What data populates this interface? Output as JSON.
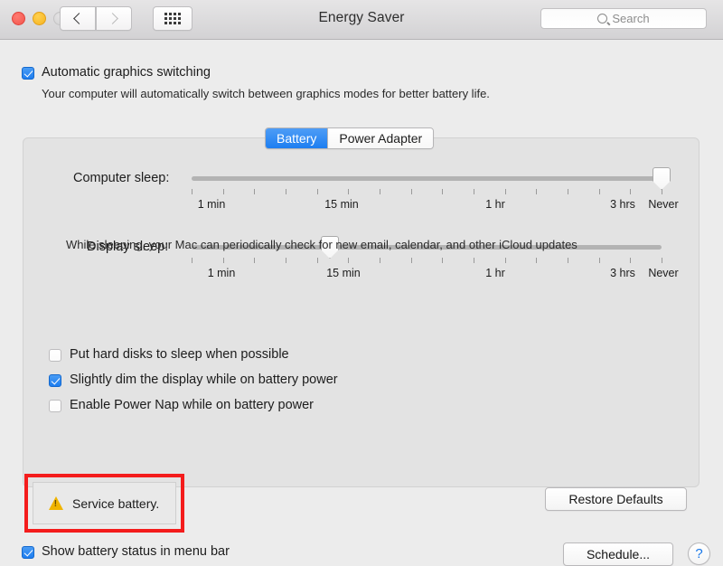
{
  "window": {
    "title": "Energy Saver",
    "traffic_lights": [
      "close",
      "minimize",
      "zoom"
    ],
    "nav_back": "back-chevron",
    "nav_forward": "forward-chevron",
    "show_all": "show-all-grid"
  },
  "search": {
    "placeholder": "Search",
    "value": "",
    "icon": "search-icon"
  },
  "graphics_switching": {
    "label": "Automatic graphics switching",
    "checked": true,
    "description": "Your computer will automatically switch between graphics modes for better battery life."
  },
  "tabs": {
    "items": [
      {
        "label": "Battery",
        "selected": true
      },
      {
        "label": "Power Adapter",
        "selected": false
      }
    ]
  },
  "sliders": [
    {
      "label": "Computer sleep:",
      "value": "Never",
      "value_position_pct": 100,
      "tick_labels": [
        {
          "text": "1 min",
          "pos_pct": 2
        },
        {
          "text": "15 min",
          "pos_pct": 27.5
        },
        {
          "text": "1 hr",
          "pos_pct": 59.5
        },
        {
          "text": "3 hrs",
          "pos_pct": 92
        },
        {
          "text": "Never",
          "pos_pct": 100
        }
      ],
      "tick_count": 16
    },
    {
      "label": "Display sleep:",
      "value": "15 min",
      "value_position_pct": 27.5,
      "tick_labels": [
        {
          "text": "1 min",
          "pos_pct": 2
        },
        {
          "text": "15 min",
          "pos_pct": 27.5
        },
        {
          "text": "1 hr",
          "pos_pct": 59.5
        },
        {
          "text": "3 hrs",
          "pos_pct": 92
        },
        {
          "text": "Never",
          "pos_pct": 100
        }
      ],
      "tick_count": 16
    }
  ],
  "options": [
    {
      "label": "Put hard disks to sleep when possible",
      "checked": false
    },
    {
      "label": "Slightly dim the display while on battery power",
      "checked": true
    },
    {
      "label": "Enable Power Nap while on battery power",
      "checked": false
    }
  ],
  "power_nap_description": "While sleeping, your Mac can periodically check for new email, calendar, and other iCloud updates",
  "service_battery": {
    "text": "Service battery.",
    "icon": "warning-triangle-icon",
    "annotation_color": "#f41c1c",
    "icon_color": "#f0b400"
  },
  "buttons": {
    "restore_defaults": "Restore Defaults",
    "schedule": "Schedule...",
    "help": "?"
  },
  "menu_bar_option": {
    "label": "Show battery status in menu bar",
    "checked": true
  },
  "colors": {
    "accent_blue": "#1d7ef1",
    "window_bg": "#ececec",
    "panel_bg": "#e3e3e3",
    "titlebar_bg": "#d8d7d9"
  }
}
